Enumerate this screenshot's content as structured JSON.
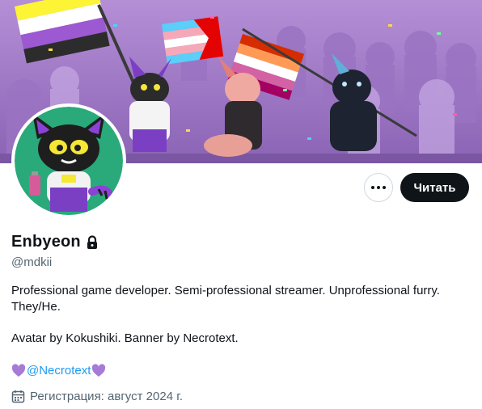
{
  "profile": {
    "display_name": "Enbyeon",
    "handle": "@mdkii",
    "bio_line1": "Professional game developer. Semi-professional streamer. Unprofessional furry.",
    "bio_line2": "They/He.",
    "bio_line3": "Avatar by Kokushiki. Banner by Necrotext.",
    "bio_mention": "@Necrotext",
    "joined": "Регистрация: август 2024 г."
  },
  "actions": {
    "follow_label": "Читать"
  },
  "icons": {
    "more": "more-horizontal-icon",
    "lock": "lock-icon",
    "calendar": "calendar-icon",
    "heart": "purple-heart-emoji"
  },
  "colors": {
    "accent": "#1d9bf0",
    "text_primary": "#0f1419",
    "text_secondary": "#536471",
    "button_dark": "#0f1419",
    "banner_bg": "#a37fc8",
    "avatar_bg": "#2aa97a",
    "heart": "#a67bd6"
  }
}
